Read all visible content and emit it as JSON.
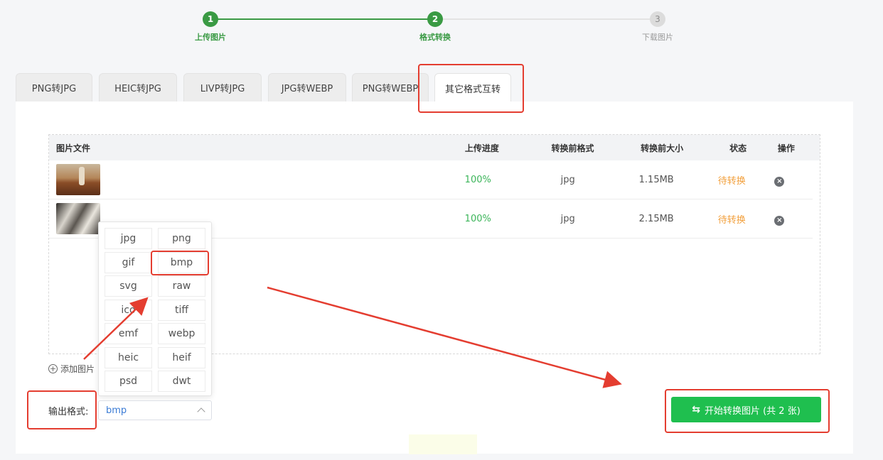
{
  "stepper": {
    "steps": [
      {
        "number": "1",
        "label": "上传图片"
      },
      {
        "number": "2",
        "label": "格式转换"
      },
      {
        "number": "3",
        "label": "下载图片"
      }
    ]
  },
  "tabs": [
    {
      "label": "PNG转JPG"
    },
    {
      "label": "HEIC转JPG"
    },
    {
      "label": "LIVP转JPG"
    },
    {
      "label": "JPG转WEBP"
    },
    {
      "label": "PNG转WEBP"
    },
    {
      "label": "其它格式互转",
      "active": true
    }
  ],
  "table": {
    "headers": {
      "file": "图片文件",
      "progress": "上传进度",
      "format": "转换前格式",
      "size": "转换前大小",
      "status": "状态",
      "action": "操作"
    },
    "rows": [
      {
        "progress": "100%",
        "format": "jpg",
        "size": "1.15MB",
        "status": "待转换"
      },
      {
        "progress": "100%",
        "format": "jpg",
        "size": "2.15MB",
        "status": "待转换"
      }
    ]
  },
  "add_image": {
    "label": "添加图片"
  },
  "format_options": [
    "jpg",
    "png",
    "gif",
    "bmp",
    "svg",
    "raw",
    "ico",
    "tiff",
    "emf",
    "webp",
    "heic",
    "heif",
    "psd",
    "dwt"
  ],
  "output": {
    "label": "输出格式:",
    "selected": "bmp"
  },
  "start_button": {
    "label": "开始转换图片 (共 2 张)"
  },
  "colors": {
    "accent": "#3a9a44",
    "button": "#1fbf4f",
    "annotation": "#e43d30",
    "status_pending": "#f2a03d"
  }
}
